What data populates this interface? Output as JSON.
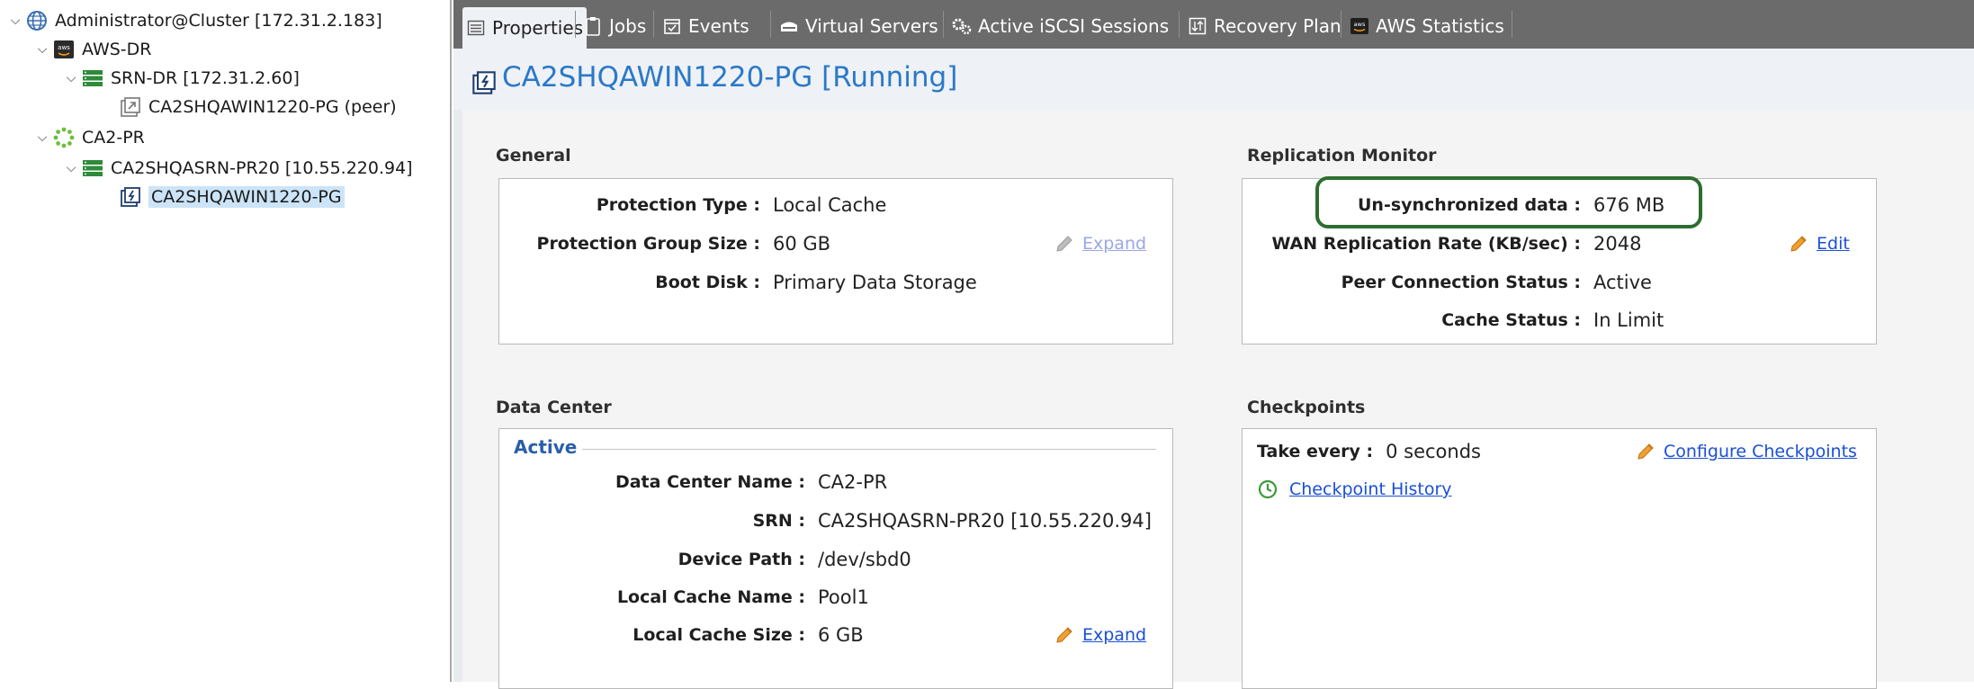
{
  "tree": {
    "root": "Administrator@Cluster [172.31.2.183]",
    "site1": "AWS-DR",
    "srn1": "SRN-DR [172.31.2.60]",
    "pg_peer": "CA2SHQAWIN1220-PG (peer)",
    "site2": "CA2-PR",
    "srn2": "CA2SHQASRN-PR20 [10.55.220.94]",
    "pg": "CA2SHQAWIN1220-PG"
  },
  "tabs": [
    "Properties",
    "Jobs",
    "Events",
    "Virtual Servers",
    "Active iSCSI Sessions",
    "Recovery Plan",
    "AWS Statistics"
  ],
  "page": {
    "title": "CA2SHQAWIN1220-PG [Running]"
  },
  "general": {
    "title": "General",
    "protection_type_label": "Protection Type :",
    "protection_type": "Local Cache",
    "pg_size_label": "Protection Group Size :",
    "pg_size": "60 GB",
    "boot_disk_label": "Boot Disk :",
    "boot_disk": "Primary Data Storage",
    "expand": "Expand"
  },
  "replication": {
    "title": "Replication Monitor",
    "unsync_label": "Un-synchronized data :",
    "unsync": "676 MB",
    "wan_label": "WAN Replication Rate (KB/sec) :",
    "wan": "2048",
    "edit": "Edit",
    "peer_label": "Peer Connection Status :",
    "peer": "Active",
    "cache_label": "Cache Status :",
    "cache": "In Limit"
  },
  "datacenter": {
    "title": "Data Center",
    "active": "Active",
    "dc_name_label": "Data Center Name :",
    "dc_name": "CA2-PR",
    "srn_label": "SRN :",
    "srn": "CA2SHQASRN-PR20 [10.55.220.94]",
    "device_label": "Device Path :",
    "device": "/dev/sbd0",
    "cache_name_label": "Local Cache Name :",
    "cache_name": "Pool1",
    "cache_size_label": "Local Cache Size :",
    "cache_size": "6 GB",
    "expand": "Expand"
  },
  "checkpoints": {
    "title": "Checkpoints",
    "take_every_label": "Take every :",
    "take_every": "0 seconds",
    "configure": "Configure Checkpoints",
    "history": "Checkpoint History"
  },
  "colors": {
    "link": "#1a4fd6",
    "title": "#2a79c8",
    "highlight": "#2c6e2f",
    "tabbar": "#6b6b6b"
  }
}
